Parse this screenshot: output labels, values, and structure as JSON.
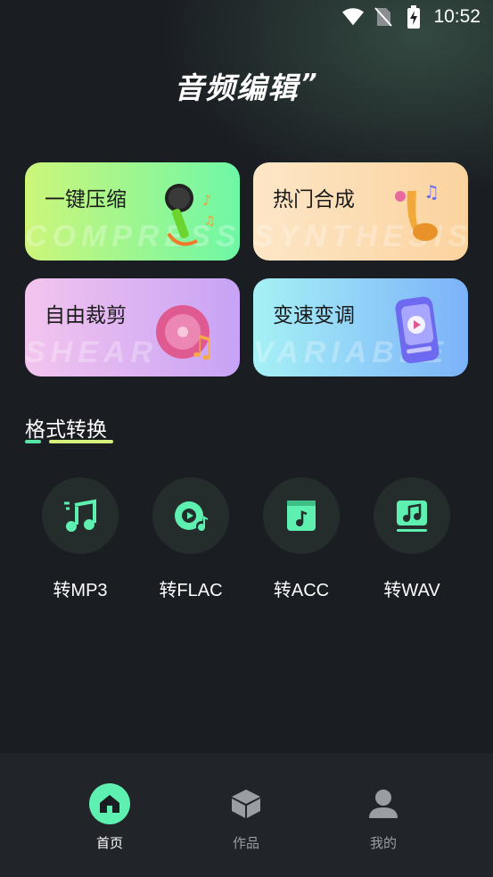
{
  "status_bar": {
    "time": "10:52",
    "icons": [
      "wifi-icon",
      "no-sim-icon",
      "battery-charging-icon"
    ]
  },
  "header": {
    "title": "音频编辑",
    "title_quote": "”"
  },
  "features": [
    {
      "label": "一键压缩",
      "watermark": "COMPRESS",
      "icon": "microphone-icon",
      "gradient": [
        "#cdf67a",
        "#6ef7a6"
      ]
    },
    {
      "label": "热门合成",
      "watermark": "SYNTHESIS",
      "icon": "saxophone-icon",
      "gradient": [
        "#fde6c7",
        "#fbd39e"
      ]
    },
    {
      "label": "自由裁剪",
      "watermark": "SHEAR",
      "icon": "vinyl-note-icon",
      "gradient": [
        "#f3c4ee",
        "#c7a3f6"
      ]
    },
    {
      "label": "变速变调",
      "watermark": "VARIABLE",
      "icon": "phone-player-icon",
      "gradient": [
        "#a6f1f6",
        "#7cb2f9"
      ]
    }
  ],
  "section": {
    "title": "格式转换"
  },
  "formats": [
    {
      "label": "转MP3",
      "icon": "music-note-icon"
    },
    {
      "label": "转FLAC",
      "icon": "disc-note-icon"
    },
    {
      "label": "转ACC",
      "icon": "music-book-icon"
    },
    {
      "label": "转WAV",
      "icon": "music-screen-icon"
    }
  ],
  "bottom_nav": [
    {
      "label": "首页",
      "icon": "home-icon",
      "active": true
    },
    {
      "label": "作品",
      "icon": "cube-icon",
      "active": false
    },
    {
      "label": "我的",
      "icon": "user-icon",
      "active": false
    }
  ],
  "colors": {
    "accent": "#5ef0b0",
    "background": "#1a1d22",
    "nav_background": "#21252a",
    "icon_circle": "#252d2c"
  }
}
